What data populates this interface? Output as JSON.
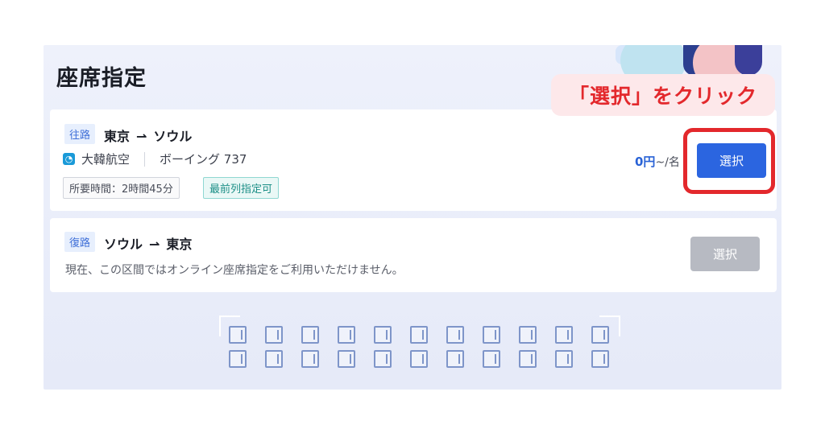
{
  "page": {
    "title": "座席指定",
    "callout": "「選択」をクリック"
  },
  "outbound": {
    "direction_label": "往路",
    "from": "東京",
    "to": "ソウル",
    "arrow": "⇀",
    "airline": "大韓航空",
    "aircraft": "ボーイング 737",
    "duration_tag": "所要時間：2時間45分",
    "front_row_tag": "最前列指定可",
    "price_amount": "0円",
    "price_suffix": "~/名",
    "select_label": "選択"
  },
  "return": {
    "direction_label": "復路",
    "from": "ソウル",
    "to": "東京",
    "arrow": "⇀",
    "note": "現在、この区間ではオンライン座席指定をご利用いただけません。",
    "select_label": "選択"
  },
  "colors": {
    "accent": "#2b65e0",
    "highlight": "#e3282c",
    "disabled": "#b7bac2"
  }
}
